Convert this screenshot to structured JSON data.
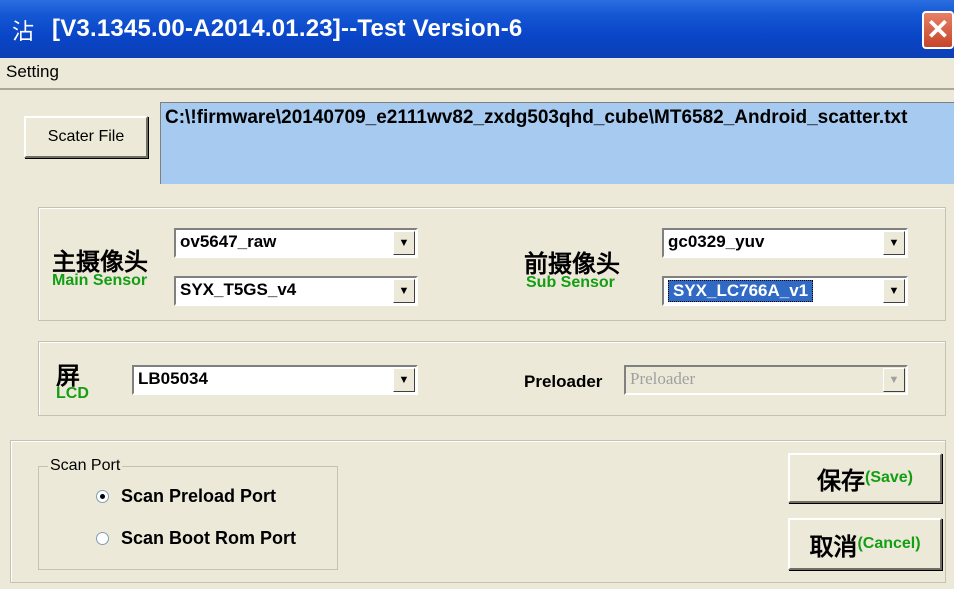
{
  "window": {
    "icon_glyph": "沾",
    "title": "[V3.1345.00-A2014.01.23]--Test Version-6",
    "close_glyph": "✕"
  },
  "menu": {
    "items": [
      "Setting"
    ]
  },
  "scatter": {
    "button_label": "Scater File",
    "path": "C:\\!firmware\\20140709_e2111wv82_zxdg503qhd_cube\\MT6582_Android_scatter.txt"
  },
  "sensors": {
    "main_cn": "主摄像头",
    "main_en": "Main Sensor",
    "main_sensor_value": "ov5647_raw",
    "main_module_value": "SYX_T5GS_v4",
    "sub_cn": "前摄像头",
    "sub_en": "Sub Sensor",
    "sub_sensor_value": "gc0329_yuv",
    "sub_module_value": "SYX_LC766A_v1"
  },
  "lcd": {
    "cn": "屏",
    "en": "LCD",
    "value": "LB05034",
    "preloader_label": "Preloader",
    "preloader_value": "Preloader"
  },
  "scan_port": {
    "legend": "Scan Port",
    "options": [
      {
        "label": "Scan Preload Port",
        "selected": true
      },
      {
        "label": "Scan Boot Rom Port",
        "selected": false
      }
    ]
  },
  "actions": {
    "save_cn": "保存",
    "save_en": "(Save)",
    "cancel_cn": "取消",
    "cancel_en": "(Cancel)"
  },
  "icons": {
    "dropdown": "▼"
  },
  "colors": {
    "title_bar": "#0a46c9",
    "path_bg": "#a6caf0",
    "english_label": "#139e13",
    "selection": "#316ac5"
  }
}
